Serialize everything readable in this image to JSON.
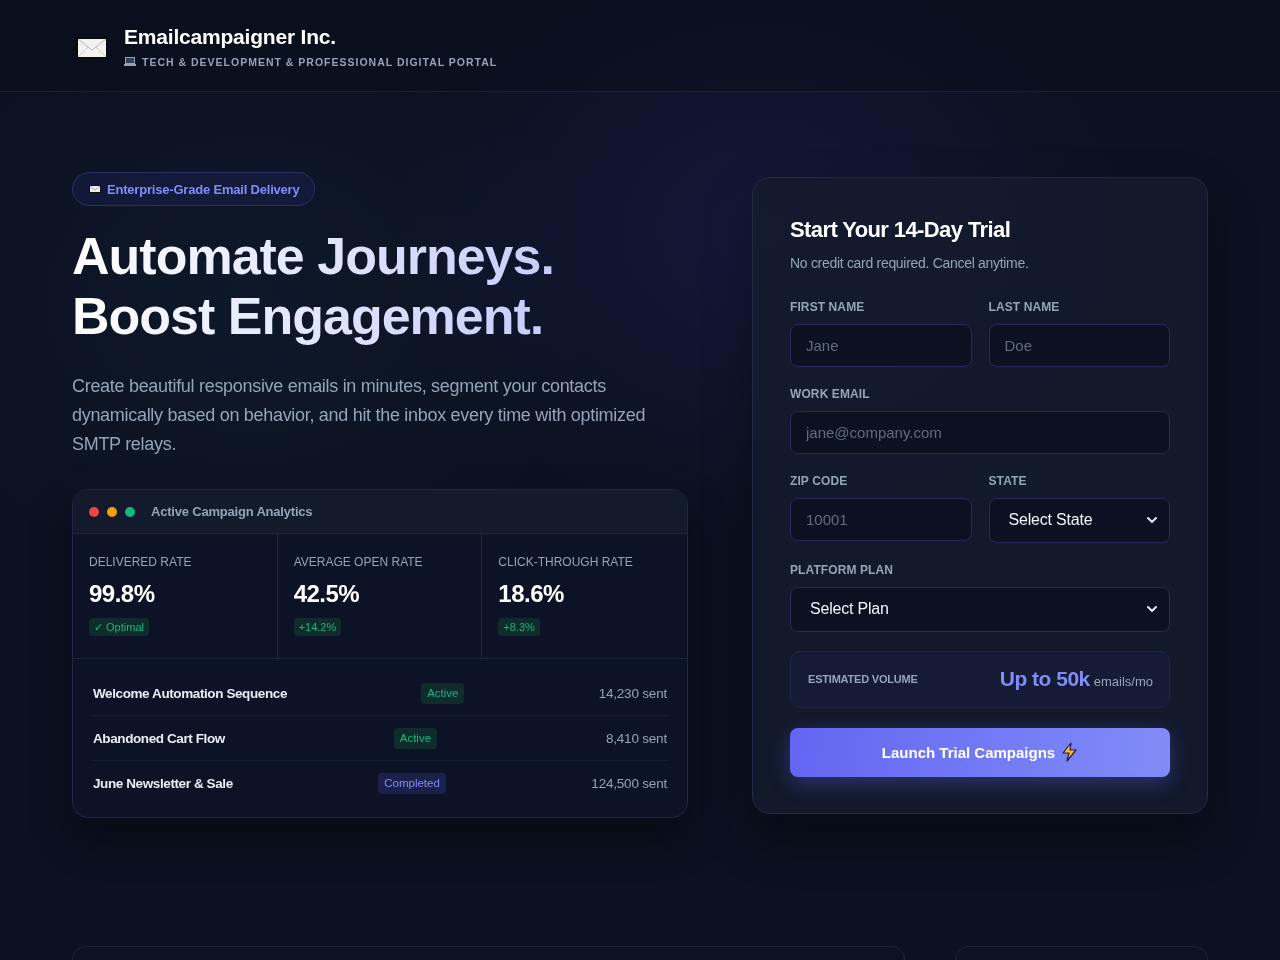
{
  "header": {
    "title": "Emailcampaigner Inc.",
    "subtitle": "TECH & DEVELOPMENT & PROFESSIONAL DIGITAL PORTAL"
  },
  "hero": {
    "badge": "Enterprise-Grade Email Delivery",
    "headline": [
      "Automate Journeys.",
      "Boost Engagement."
    ],
    "description": "Create beautiful responsive emails in minutes, segment your contacts dynamically based on behavior, and hit the inbox every time with optimized SMTP relays."
  },
  "analytics": {
    "window_dots": [
      {
        "color": "#ef4444"
      },
      {
        "color": "#f59e0b"
      },
      {
        "color": "#10b981"
      }
    ],
    "title": "Active Campaign Analytics",
    "stats": [
      {
        "label": "DELIVERED RATE",
        "value": "99.8%",
        "chip": "✓ Optimal"
      },
      {
        "label": "AVERAGE OPEN RATE",
        "value": "42.5%",
        "chip": "+14.2%"
      },
      {
        "label": "CLICK-THROUGH RATE",
        "value": "18.6%",
        "chip": "+8.3%"
      }
    ],
    "campaigns": [
      {
        "name": "Welcome Automation Sequence",
        "status": {
          "kind": "active",
          "label": "Active"
        },
        "sent": "14,230 sent"
      },
      {
        "name": "Abandoned Cart Flow",
        "status": {
          "kind": "active",
          "label": "Active"
        },
        "sent": "8,410 sent"
      },
      {
        "name": "June Newsletter & Sale",
        "status": {
          "kind": "completed",
          "label": "Completed"
        },
        "sent": "124,500 sent"
      }
    ]
  },
  "signup_form": {
    "title": "Start Your 14-Day Trial",
    "subtitle": "No credit card required. Cancel anytime.",
    "field_rows": [
      [
        {
          "kind": "input",
          "label": "FIRST NAME",
          "placeholder": "Jane"
        },
        {
          "kind": "input",
          "label": "LAST NAME",
          "placeholder": "Doe"
        }
      ],
      [
        {
          "kind": "input",
          "label": "WORK EMAIL",
          "placeholder": "jane@company.com"
        }
      ],
      [
        {
          "kind": "input",
          "label": "ZIP CODE",
          "placeholder": "10001"
        },
        {
          "kind": "select",
          "label": "STATE",
          "value": "Select State"
        }
      ],
      [
        {
          "kind": "select",
          "label": "PLATFORM PLAN",
          "value": "Select Plan"
        }
      ]
    ],
    "estimate": {
      "label": "ESTIMATED VOLUME",
      "value": "Up to 50k",
      "unit": "emails/mo"
    },
    "submit": "Launch Trial Campaigns"
  }
}
